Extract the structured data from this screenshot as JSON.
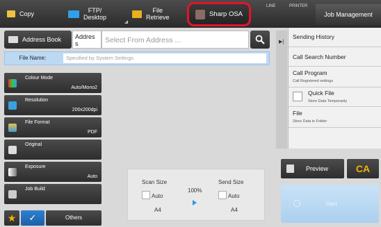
{
  "top_tabs": {
    "copy": "Copy",
    "ftp": "FTP/\nDesktop",
    "ftp_line1": "FTP/",
    "ftp_line2": "Desktop",
    "file_retrieve_line1": "File",
    "file_retrieve_line2": "Retrieve",
    "sharp_osa": "Sharp OSA",
    "line_indicator": "LINE",
    "printer_indicator": "PRINTER",
    "job_management": "Job Management"
  },
  "address": {
    "book_label": "Address Book",
    "field_label_line1": "Addres",
    "field_label_line2": "s",
    "input_placeholder": "Select From Address ..."
  },
  "file_name": {
    "label": "File Name:",
    "value": "Specified by System Settings"
  },
  "settings": [
    {
      "name": "Colour Mode",
      "value": "Auto/Mono2",
      "icon": "colour-mode-icon"
    },
    {
      "name": "Resolution",
      "value": "200x200dpi",
      "icon": "resolution-icon"
    },
    {
      "name": "File Format",
      "value": "PDF",
      "icon": "file-format-icon"
    },
    {
      "name": "Original",
      "value": "",
      "icon": "original-icon"
    },
    {
      "name": "Exposure",
      "value": "Auto",
      "icon": "exposure-icon"
    },
    {
      "name": "Job Build",
      "value": "",
      "icon": "job-build-icon"
    }
  ],
  "bottom_left": {
    "others": "Others"
  },
  "size_panel": {
    "scan_size_label": "Scan Size",
    "scan_size_mode": "Auto",
    "scan_size_paper": "A4",
    "ratio": "100%",
    "send_size_label": "Send Size",
    "send_size_mode": "Auto",
    "send_size_paper": "A4"
  },
  "right_panel": {
    "sending_history": "Sending History",
    "call_search_number": "Call Search Number",
    "call_program": "Call Program",
    "call_program_sub": "Call Registered settings",
    "quick_file": "Quick File",
    "quick_file_sub": "Store Data Temporarily",
    "file": "File",
    "file_sub": "Store Data in Folder"
  },
  "actions": {
    "preview": "Preview",
    "ca": "CA",
    "start": "Start"
  },
  "colors": {
    "highlight_border": "#e3142a",
    "accent_blue": "#2f7fd0",
    "ca_yellow": "#f0b400",
    "file_row_bg": "#bcd9f3"
  }
}
